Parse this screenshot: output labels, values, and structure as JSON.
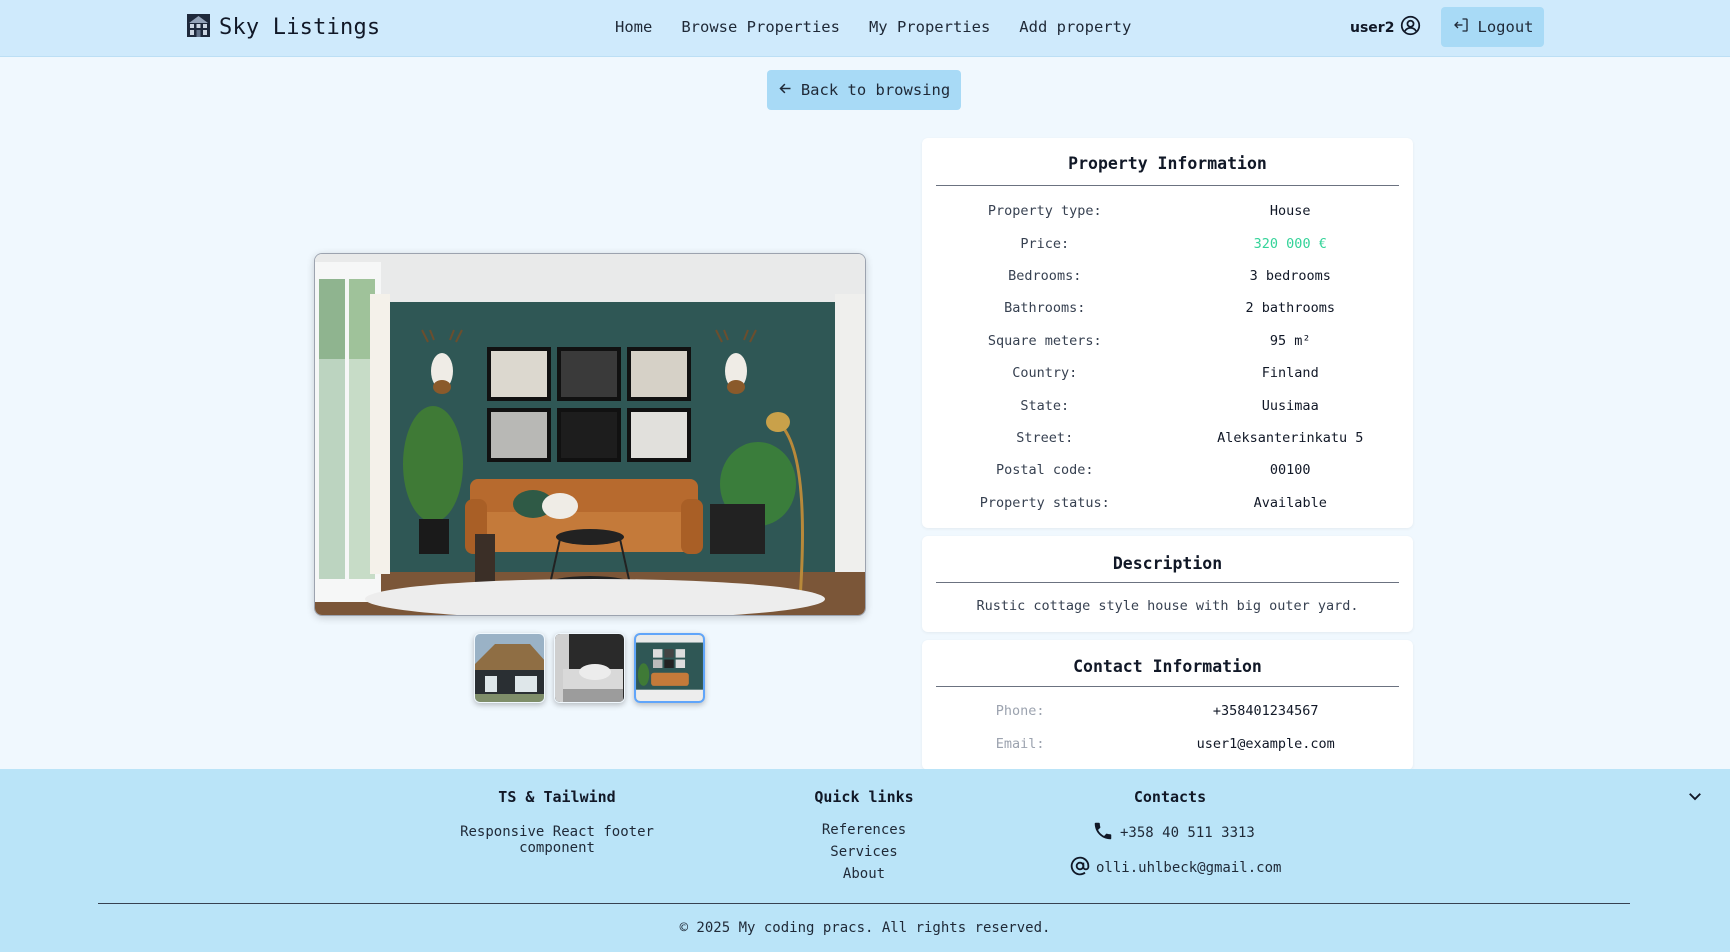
{
  "header": {
    "brand": "Sky Listings",
    "nav": [
      "Home",
      "Browse Properties",
      "My Properties",
      "Add property"
    ],
    "username": "user2",
    "logout_label": "Logout"
  },
  "back_label": "Back to browsing",
  "gallery": {
    "main_image_icon": "living-room-photo",
    "thumbnails": [
      "house-exterior-photo",
      "bedroom-photo",
      "living-room-photo"
    ],
    "active_index": 2
  },
  "property_info": {
    "title": "Property Information",
    "rows": [
      {
        "label": "Property type:",
        "value": "House"
      },
      {
        "label": "Price:",
        "value": "320 000 €"
      },
      {
        "label": "Bedrooms:",
        "value": "3 bedrooms"
      },
      {
        "label": "Bathrooms:",
        "value": "2 bathrooms"
      },
      {
        "label": "Square meters:",
        "value": "95 m²"
      },
      {
        "label": "Country:",
        "value": "Finland"
      },
      {
        "label": "State:",
        "value": "Uusimaa"
      },
      {
        "label": "Street:",
        "value": "Aleksanterinkatu 5"
      },
      {
        "label": "Postal code:",
        "value": "00100"
      },
      {
        "label": "Property status:",
        "value": "Available"
      }
    ]
  },
  "description": {
    "title": "Description",
    "text": "Rustic cottage style house with big outer yard."
  },
  "contact": {
    "title": "Contact Information",
    "phone_label": "Phone:",
    "phone": "+358401234567",
    "email_label": "Email:",
    "email": "user1@example.com"
  },
  "footer": {
    "col1_title": "TS & Tailwind",
    "col1_text": "Responsive React footer component",
    "col2_title": "Quick links",
    "links": [
      "References",
      "Services",
      "About"
    ],
    "col3_title": "Contacts",
    "phone": "+358 40 511 3313",
    "email": "olli.uhlbeck@gmail.com",
    "copyright": "© 2025 My coding pracs. All rights reserved."
  },
  "colors": {
    "header_bg": "#cfeafc",
    "button_bg": "#a8daf6",
    "footer_bg": "#bae4f8",
    "price": "#34d399"
  }
}
